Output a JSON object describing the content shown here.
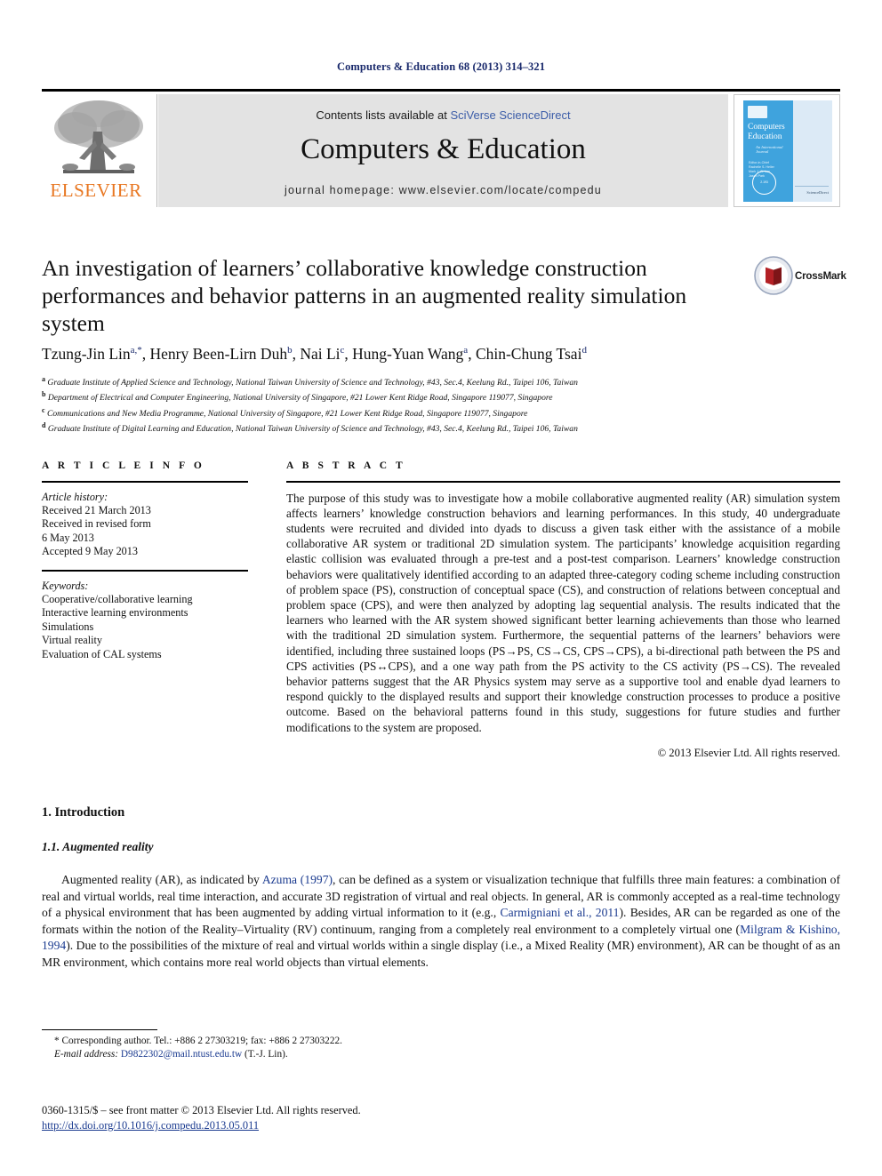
{
  "running_head": "Computers & Education 68 (2013) 314–321",
  "header": {
    "publisher_logo_name": "ELSEVIER",
    "contents_prefix": "Contents lists available at ",
    "contents_link": "SciVerse ScienceDirect",
    "journal_name": "Computers & Education",
    "homepage_line": "journal homepage: www.elsevier.com/locate/compedu",
    "cover": {
      "title_line1": "Computers",
      "amp": "&",
      "title_line2": "Education",
      "subtitle": "An International Journal",
      "editors": "Editor-in-Chief\nRachelle S. Heller\nMark J. W. Lee\nJason Chang-Hwa Park",
      "seal_text": "IMPACT FACTOR 2.193",
      "publisher_foot": "ScienceDirect"
    }
  },
  "article": {
    "title": "An investigation of learners’ collaborative knowledge construction performances and behavior patterns in an augmented reality simulation system",
    "crossmark_label": "CrossMark",
    "authors_html": "Tzung-Jin Lin<sup>a,</sup><sup>*</sup>, Henry Been-Lirn Duh<sup>b</sup>, Nai Li<sup>c</sup>, Hung-Yuan Wang<sup>a</sup>, Chin-Chung Tsai<sup>d</sup>",
    "affiliations": [
      {
        "mark": "a",
        "text": "Graduate Institute of Applied Science and Technology, National Taiwan University of Science and Technology, #43, Sec.4, Keelung Rd., Taipei 106, Taiwan"
      },
      {
        "mark": "b",
        "text": "Department of Electrical and Computer Engineering, National University of Singapore, #21 Lower Kent Ridge Road, Singapore 119077, Singapore"
      },
      {
        "mark": "c",
        "text": "Communications and New Media Programme, National University of Singapore, #21 Lower Kent Ridge Road, Singapore 119077, Singapore"
      },
      {
        "mark": "d",
        "text": "Graduate Institute of Digital Learning and Education, National Taiwan University of Science and Technology, #43, Sec.4, Keelung Rd., Taipei 106, Taiwan"
      }
    ]
  },
  "article_info": {
    "heading": "A R T I C L E  I N F O",
    "history_label": "Article history:",
    "history": [
      "Received 21 March 2013",
      "Received in revised form",
      "6 May 2013",
      "Accepted 9 May 2013"
    ],
    "keywords_label": "Keywords:",
    "keywords": [
      "Cooperative/collaborative learning",
      "Interactive learning environments",
      "Simulations",
      "Virtual reality",
      "Evaluation of CAL systems"
    ]
  },
  "abstract": {
    "heading": "A B S T R A C T",
    "text": "The purpose of this study was to investigate how a mobile collaborative augmented reality (AR) simulation system affects learners’ knowledge construction behaviors and learning performances. In this study, 40 undergraduate students were recruited and divided into dyads to discuss a given task either with the assistance of a mobile collaborative AR system or traditional 2D simulation system. The participants’ knowledge acquisition regarding elastic collision was evaluated through a pre-test and a post-test comparison. Learners’ knowledge construction behaviors were qualitatively identified according to an adapted three-category coding scheme including construction of problem space (PS), construction of conceptual space (CS), and construction of relations between conceptual and problem space (CPS), and were then analyzed by adopting lag sequential analysis. The results indicated that the learners who learned with the AR system showed significant better learning achievements than those who learned with the traditional 2D simulation system. Furthermore, the sequential patterns of the learners’ behaviors were identified, including three sustained loops (PS→PS, CS→CS, CPS→CPS), a bi-directional path between the PS and CPS activities (PS↔CPS), and a one way path from the PS activity to the CS activity (PS→CS). The revealed behavior patterns suggest that the AR Physics system may serve as a supportive tool and enable dyad learners to respond quickly to the displayed results and support their knowledge construction processes to produce a positive outcome. Based on the behavioral patterns found in this study, suggestions for future studies and further modifications to the system are proposed.",
    "copyright": "© 2013 Elsevier Ltd. All rights reserved."
  },
  "body": {
    "section_number_title": "1. Introduction",
    "subsection_number_title": "1.1. Augmented reality",
    "paragraph_html": "Augmented reality (AR), as indicated by <span class=\"ref-link\">Azuma (1997)</span>, can be defined as a system or visualization technique that fulfills three main features: a combination of real and virtual worlds, real time interaction, and accurate 3D registration of virtual and real objects. In general, AR is commonly accepted as a real-time technology of a physical environment that has been augmented by adding virtual information to it (e.g., <span class=\"ref-link\">Carmigniani et al., 2011</span>). Besides, AR can be regarded as one of the formats within the notion of the Reality–Virtuality (RV) continuum, ranging from a completely real environment to a completely virtual one (<span class=\"ref-link\">Milgram &amp; Kishino, 1994</span>). Due to the possibilities of the mixture of real and virtual worlds within a single display (i.e., a Mixed Reality (MR) environment), AR can be thought of as an MR environment, which contains more real world objects than virtual elements."
  },
  "footer": {
    "corresponding_html": "* Corresponding author. Tel.: +886 2 27303219; fax: +886 2 27303222.",
    "email_html": "<em>E-mail address:</em> <span class=\"email-link\">D9822302@mail.ntust.edu.tw</span> (T.-J. Lin).",
    "front_matter": "0360-1315/$ – see front matter © 2013 Elsevier Ltd. All rights reserved.",
    "doi": "http://dx.doi.org/10.1016/j.compedu.2013.05.011"
  },
  "colors": {
    "running_head": "#1a2a6c",
    "link": "#1a3a8f",
    "sciencedirect": "#3b5ca8",
    "elsevier_orange": "#E87722",
    "band_gray": "#e3e3e3",
    "cover_blue": "#3fa3dd"
  }
}
